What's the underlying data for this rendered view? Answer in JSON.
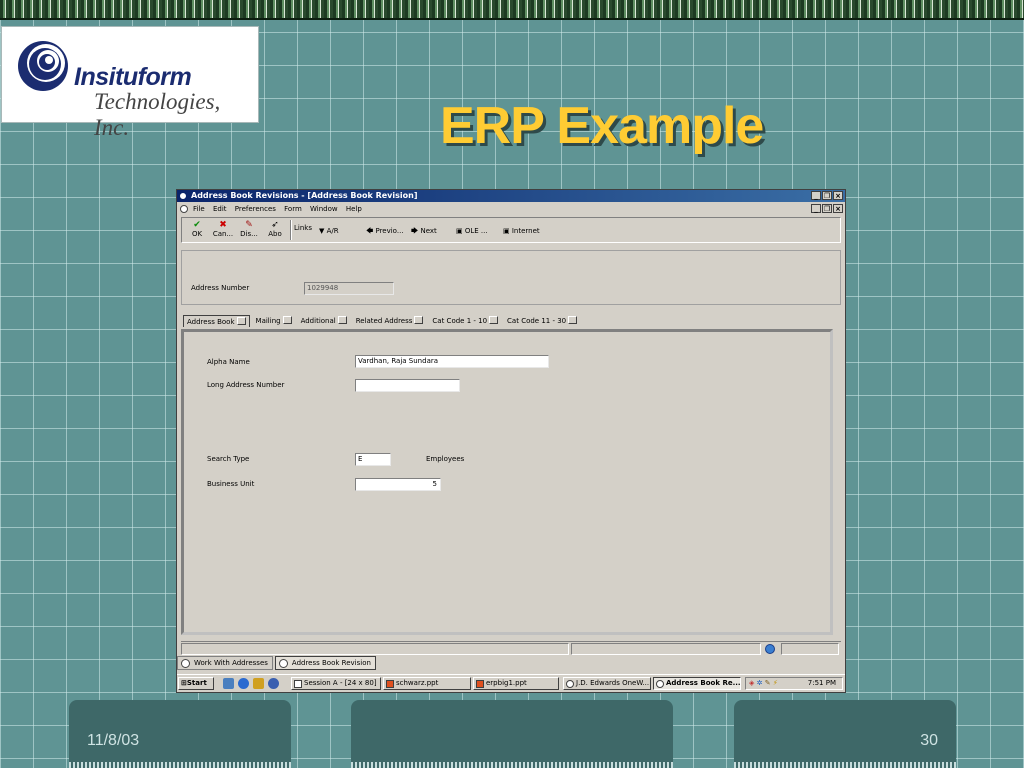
{
  "slide": {
    "title": "ERP Example",
    "logo": {
      "name": "Insituform",
      "subtitle": "Technologies, Inc."
    },
    "footer": {
      "date": "11/8/03",
      "center": "",
      "page": "30"
    }
  },
  "window": {
    "title": "Address Book Revisions - [Address Book Revision]",
    "menu": [
      "File",
      "Edit",
      "Preferences",
      "Form",
      "Window",
      "Help"
    ],
    "toolbar": {
      "ok": "OK",
      "cancel": "Can...",
      "display": "Dis...",
      "about": "Abo",
      "links": "Links",
      "ar": "A/R",
      "previous": "Previo...",
      "next": "Next",
      "ole": "OLE ...",
      "internet": "Internet"
    },
    "header": {
      "address_number_label": "Address Number",
      "address_number_value": "1029948"
    },
    "tabs": [
      "Address Book",
      "Mailing",
      "Additional",
      "Related Address",
      "Cat Code 1 - 10",
      "Cat Code 11 - 30"
    ],
    "form": {
      "alpha_name_label": "Alpha Name",
      "alpha_name_value": "Vardhan, Raja Sundara",
      "long_address_label": "Long Address Number",
      "long_address_value": "",
      "search_type_label": "Search Type",
      "search_type_value": "E",
      "search_type_desc": "Employees",
      "business_unit_label": "Business Unit",
      "business_unit_value": "5"
    },
    "window_tabs": [
      "Work With Addresses",
      "Address Book Revision"
    ],
    "taskbar": {
      "start": "Start",
      "tasks": [
        "Session A - [24 x 80]",
        "schwarz.ppt",
        "erpbig1.ppt",
        "J.D. Edwards OneW...",
        "Address Book Re..."
      ],
      "clock": "7:51 PM"
    }
  }
}
